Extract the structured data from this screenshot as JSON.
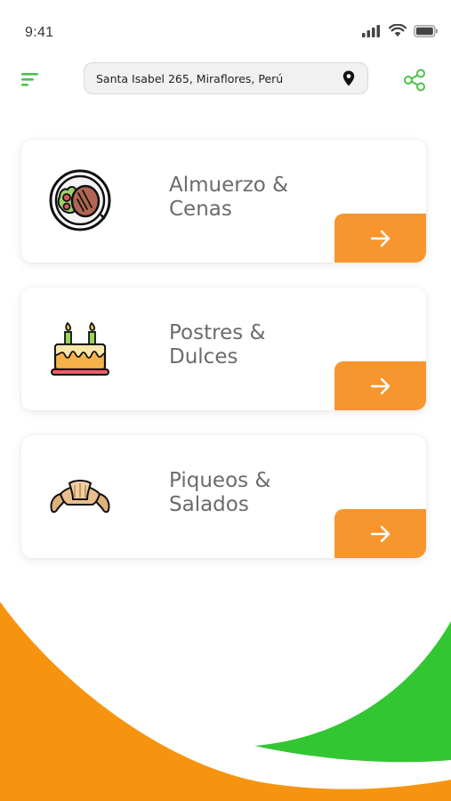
{
  "status_bar": {
    "time": "9:41"
  },
  "header": {
    "address": "Santa Isabel 265, Miraflores, Perú",
    "menu_icon": "menu-lines-icon",
    "pin_icon": "location-pin-icon",
    "share_icon": "share-icon"
  },
  "categories": [
    {
      "title": "Almuerzo &\nCenas",
      "icon": "plate-food-icon"
    },
    {
      "title": "Postres &\nDulces",
      "icon": "birthday-cake-icon"
    },
    {
      "title": "Piqueos &\nSalados",
      "icon": "croissant-icon"
    }
  ],
  "colors": {
    "accent_orange": "#f7962f",
    "accent_green": "#3cc13b",
    "bg_orange": "#f7940f",
    "bg_green": "#33c633"
  }
}
